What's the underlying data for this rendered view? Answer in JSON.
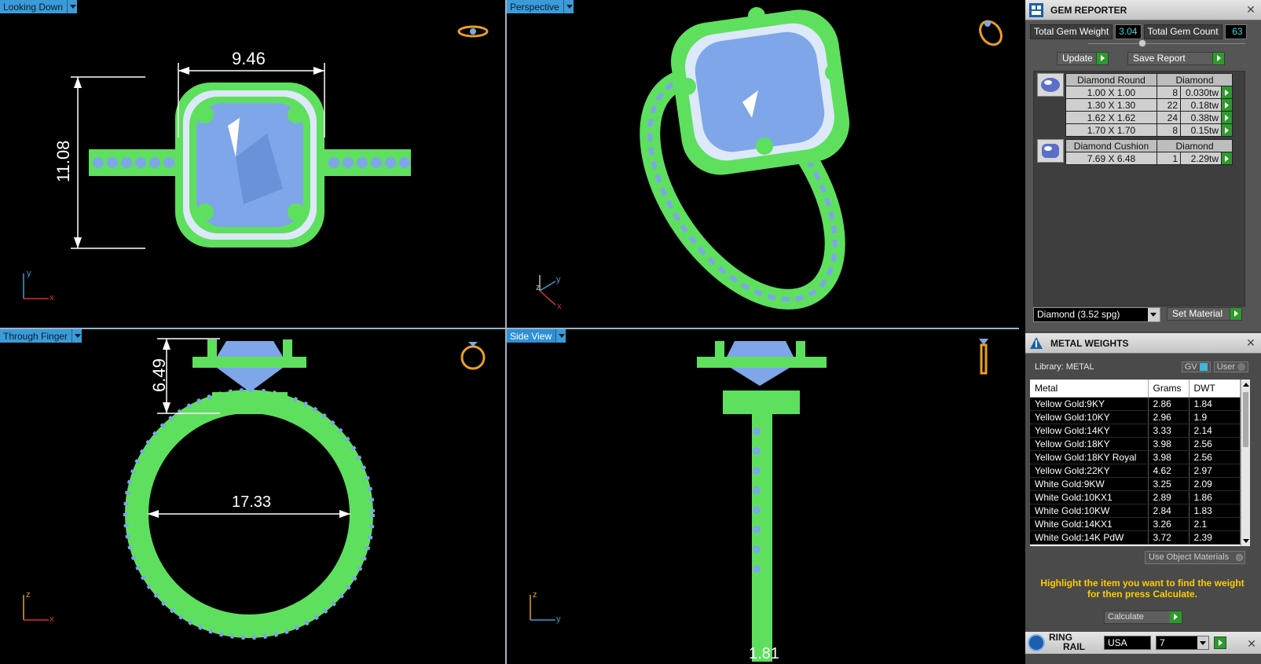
{
  "viewports": {
    "top_left": {
      "label": "Looking Down",
      "dim_width": "9.46",
      "dim_height": "11.08",
      "axis_a": "y",
      "axis_b": "x"
    },
    "top_right": {
      "label": "Perspective",
      "axis_a": "z",
      "axis_b": "y",
      "axis_c": "x"
    },
    "bottom_left": {
      "label": "Through Finger",
      "dim_height": "6.49",
      "dim_width": "17.33",
      "axis_a": "z",
      "axis_b": "x"
    },
    "bottom_right": {
      "label": "Side View",
      "dim_width": "1.81",
      "axis_a": "z",
      "axis_b": "y"
    }
  },
  "gem_reporter": {
    "title": "GEM REPORTER",
    "total_weight_label": "Total Gem Weight",
    "total_weight_value": "3.04",
    "total_count_label": "Total Gem Count",
    "total_count_value": "63",
    "update_label": "Update",
    "save_report_label": "Save Report",
    "groups": [
      {
        "header_shape": "Diamond Round",
        "header_material": "Diamond",
        "rows": [
          {
            "size": "1.00 X 1.00",
            "count": "8",
            "weight": "0.030tw"
          },
          {
            "size": "1.30 X 1.30",
            "count": "22",
            "weight": "0.18tw"
          },
          {
            "size": "1.62 X 1.62",
            "count": "24",
            "weight": "0.38tw"
          },
          {
            "size": "1.70 X 1.70",
            "count": "8",
            "weight": "0.15tw"
          }
        ]
      },
      {
        "header_shape": "Diamond Cushion",
        "header_material": "Diamond",
        "rows": [
          {
            "size": "7.69 X 6.48",
            "count": "1",
            "weight": "2.29tw"
          }
        ]
      }
    ],
    "material_select": "Diamond     (3.52 spg)",
    "set_material_label": "Set Material"
  },
  "metal_weights": {
    "title": "METAL WEIGHTS",
    "library_label": "Library: METAL",
    "gv_label": "GV",
    "user_label": "User",
    "columns": [
      "Metal",
      "Grams",
      "DWT"
    ],
    "rows": [
      [
        "Yellow Gold:9KY",
        "2.86",
        "1.84"
      ],
      [
        "Yellow Gold:10KY",
        "2.96",
        "1.9"
      ],
      [
        "Yellow Gold:14KY",
        "3.33",
        "2.14"
      ],
      [
        "Yellow Gold:18KY",
        "3.98",
        "2.56"
      ],
      [
        "Yellow Gold:18KY Royal",
        "3.98",
        "2.56"
      ],
      [
        "Yellow Gold:22KY",
        "4.62",
        "2.97"
      ],
      [
        "White Gold:9KW",
        "3.25",
        "2.09"
      ],
      [
        "White Gold:10KX1",
        "2.89",
        "1.86"
      ],
      [
        "White Gold:10KW",
        "2.84",
        "1.83"
      ],
      [
        "White Gold:14KX1",
        "3.26",
        "2.1"
      ],
      [
        "White Gold:14K PdW",
        "3.72",
        "2.39"
      ]
    ],
    "use_object_label": "Use Object Materials",
    "hint": "Highlight the item you want to find the weight for then press Calculate.",
    "calculate_label": "Calculate"
  },
  "ring_rail": {
    "title_line1": "RING",
    "title_line2": "RAIL",
    "region": "USA",
    "size": "7"
  },
  "colors": {
    "metal_green": "#5ee05e",
    "gem_blue": "#7ea6e8",
    "tab_blue": "#3b9bd9",
    "go_green": "#2e9a2e",
    "hint_yellow": "#ffcc00"
  }
}
